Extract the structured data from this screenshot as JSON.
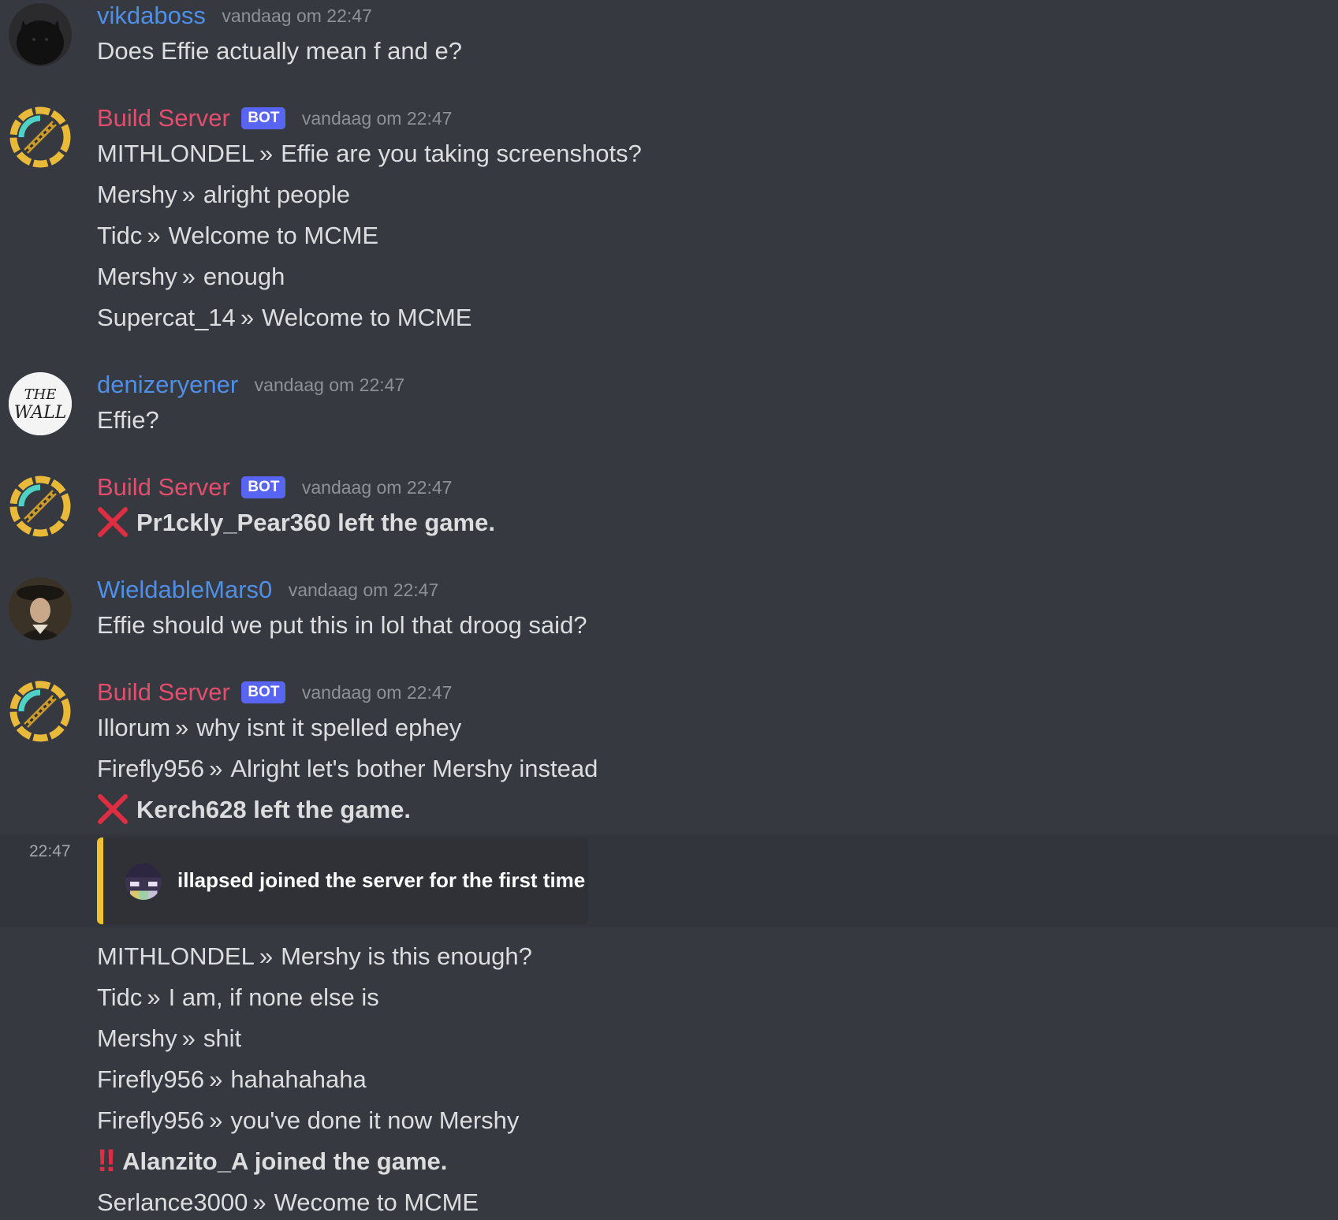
{
  "colors": {
    "background": "#36393f",
    "author_user": "#4f8fe8",
    "author_bot": "#e34d6e",
    "bot_tag": "#5865f2",
    "embed_border": "#f0c22d",
    "leave_icon": "#dd2e44"
  },
  "messages": [
    {
      "author": "vikdaboss",
      "timestamp": "vandaag om 22:47",
      "avatar_icon": "black-cat-avatar",
      "lines": [
        "Does Effie actually mean f and e?"
      ]
    },
    {
      "author": "Build Server",
      "bot_tag": "BOT",
      "timestamp": "vandaag om 22:47",
      "avatar_icon": "build-server-avatar",
      "lines": [
        {
          "user": "MITHLONDEL",
          "sep": "»",
          "text": "Effie are you taking screenshots?"
        },
        {
          "user": "Mershy",
          "sep": "»",
          "text": "alright people"
        },
        {
          "user": "Tidc",
          "sep": "»",
          "text": "Welcome to MCME"
        },
        {
          "user": "Mershy",
          "sep": "»",
          "text": "enough"
        },
        {
          "user": "Supercat_14",
          "sep": "»",
          "text": "Welcome to MCME"
        }
      ]
    },
    {
      "author": "denizeryener",
      "timestamp": "vandaag om 22:47",
      "avatar_icon": "the-wall-avatar",
      "avatar_text_1": "THE",
      "avatar_text_2": "WALL",
      "lines": [
        "Effie?"
      ]
    },
    {
      "author": "Build Server",
      "bot_tag": "BOT",
      "timestamp": "vandaag om 22:47",
      "avatar_icon": "build-server-avatar",
      "lines": [
        {
          "event_icon": "red-x-icon",
          "text": "Pr1ckly_Pear360 left the game."
        }
      ]
    },
    {
      "author": "WieldableMars0",
      "timestamp": "vandaag om 22:47",
      "avatar_icon": "portrait-avatar",
      "lines": [
        "Effie should we put this in lol that droog said?"
      ]
    },
    {
      "author": "Build Server",
      "bot_tag": "BOT",
      "timestamp": "vandaag om 22:47",
      "avatar_icon": "build-server-avatar",
      "lines": [
        {
          "user": "Illorum",
          "sep": "»",
          "text": "why isnt it spelled ephey"
        },
        {
          "user": "Firefly956",
          "sep": "»",
          "text": "Alright let's bother Mershy instead"
        },
        {
          "event_icon": "red-x-icon",
          "text": "Kerch628 left the game."
        }
      ]
    }
  ],
  "hover_row": {
    "timestamp": "22:47",
    "embed_text": "illapsed joined the server for the first time",
    "embed_icon": "player-head-icon"
  },
  "continued_lines": [
    {
      "user": "MITHLONDEL",
      "sep": "»",
      "text": "Mershy is this enough?"
    },
    {
      "user": "Tidc",
      "sep": "»",
      "text": "I am, if none else is"
    },
    {
      "user": "Mershy",
      "sep": "»",
      "text": "shit"
    },
    {
      "user": "Firefly956",
      "sep": "»",
      "text": "hahahahaha"
    },
    {
      "user": "Firefly956",
      "sep": "»",
      "text": "you've done it now Mershy"
    },
    {
      "event_icon": "double-exclamation-icon",
      "event_glyph": "‼",
      "text": "Alanzito_A joined the game."
    },
    {
      "user": "Serlance3000",
      "sep": "»",
      "text": "Wecome to MCME"
    }
  ]
}
